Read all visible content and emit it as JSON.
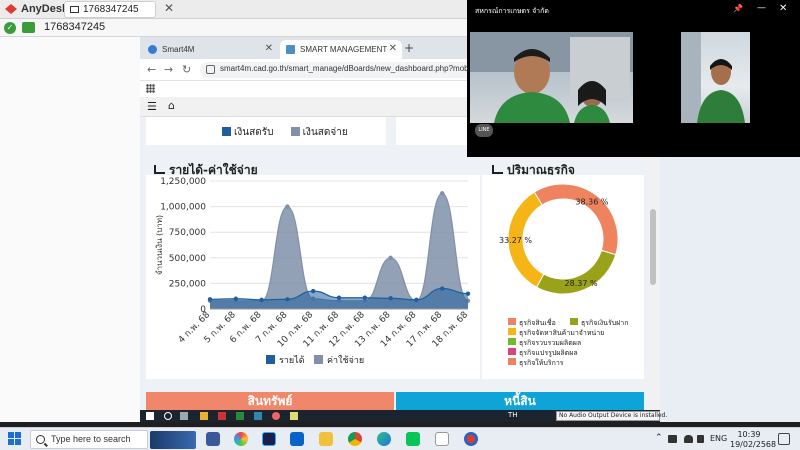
{
  "anydesk": {
    "app_name": "AnyDesk",
    "tab_label": "1768347245",
    "address": "1768347245"
  },
  "browser": {
    "tabs": [
      {
        "label": "Smart4M"
      },
      {
        "label": "SMART MANAGEMENT"
      }
    ],
    "url": "smart4m.cad.go.th/smart_manage/dBoards/new_dashboard.php?mobile="
  },
  "dashboard": {
    "top_legend": [
      "เงินสดรับ",
      "เงินสดจ่าย"
    ],
    "revenue_title": "รายได้-ค่าใช้จ่าย",
    "business_title": "ปริมาณธุรกิจ",
    "assets_button": "สินทรัพย์",
    "liabilities_button": "หนี้สิน"
  },
  "chart_data": [
    {
      "type": "area",
      "title": "รายได้-ค่าใช้จ่าย",
      "ylabel": "จำนวนเงิน (บาท)",
      "ylim": [
        0,
        1250000
      ],
      "yticks": [
        "1,250,000",
        "1,000,000",
        "750,000",
        "500,000",
        "250,000",
        "0"
      ],
      "categories": [
        "4 ก.พ. 68",
        "5 ก.พ. 68",
        "6 ก.พ. 68",
        "7 ก.พ. 68",
        "10 ก.พ. 68",
        "11 ก.พ. 68",
        "12 ก.พ. 68",
        "13 ก.พ. 68",
        "14 ก.พ. 68",
        "17 ก.พ. 68",
        "18 ก.พ. 68"
      ],
      "series": [
        {
          "name": "รายได้",
          "color": "#1f5f9f",
          "values": [
            95000,
            100000,
            90000,
            95000,
            175000,
            110000,
            110000,
            105000,
            90000,
            200000,
            150000
          ]
        },
        {
          "name": "ค่าใช้จ่าย",
          "color": "#7f90a8",
          "values": [
            80000,
            80000,
            80000,
            1000000,
            100000,
            80000,
            80000,
            500000,
            80000,
            1130000,
            80000
          ]
        }
      ],
      "legend": "bottom",
      "grid": true
    },
    {
      "type": "pie",
      "title": "ปริมาณธุรกิจ",
      "donut": true,
      "slices": [
        {
          "label": "ธุรกิจสินเชื่อ",
          "value": 38.36,
          "display": "38.36 %",
          "color": "#ef8360"
        },
        {
          "label": "ธุรกิจเงินรับฝาก",
          "value": 28.37,
          "display": "28.37 %",
          "color": "#9aa21a"
        },
        {
          "label": "ธุรกิจจัดหาสินค้ามาจำหน่าย",
          "value": 33.27,
          "display": "33.27 %",
          "color": "#f5b516"
        },
        {
          "label": "ธุรกิจรวบรวมผลิตผล",
          "value": 0,
          "display": "",
          "color": "#76b82a"
        },
        {
          "label": "ธุรกิจแปรรูปผลิตผล",
          "value": 0,
          "display": "",
          "color": "#d9457a"
        },
        {
          "label": "ธุรกิจให้บริการ",
          "value": 0,
          "display": "",
          "color": "#ef8360"
        }
      ],
      "legend": "bottom"
    }
  ],
  "video_call": {
    "title": "สหกรณ์การเกษตร จำกัด"
  },
  "remote_taskbar": {
    "lang": "TH",
    "tooltip": "No Audio Output Device is installed."
  },
  "taskbar": {
    "search_placeholder": "Type here to search",
    "lang": "ENG",
    "time": "10:39",
    "date": "19/02/2568"
  }
}
